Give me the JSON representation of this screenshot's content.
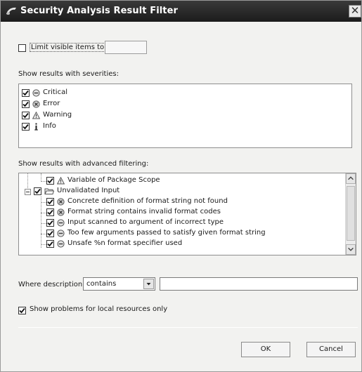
{
  "window": {
    "title": "Security Analysis Result Filter",
    "close_glyph": "✕"
  },
  "limit": {
    "label": "Limit visible items to:",
    "checked": false,
    "value": ""
  },
  "severities": {
    "label": "Show results with severities:",
    "items": [
      {
        "label": "Critical",
        "icon": "critical-icon",
        "checked": true
      },
      {
        "label": "Error",
        "icon": "error-icon",
        "checked": true
      },
      {
        "label": "Warning",
        "icon": "warning-icon",
        "checked": true
      },
      {
        "label": "Info",
        "icon": "info-icon",
        "checked": true
      }
    ]
  },
  "advanced": {
    "label": "Show results with advanced filtering:",
    "rows": [
      {
        "label": "Variable of Package Scope",
        "icon": "warning-icon",
        "checked": true
      },
      {
        "label": "Unvalidated Input",
        "icon": "folder-icon",
        "checked": true,
        "expanded": true
      },
      {
        "label": "Concrete definition of format string not found",
        "icon": "error-icon",
        "checked": true
      },
      {
        "label": "Format string contains invalid format codes",
        "icon": "error-icon",
        "checked": true
      },
      {
        "label": "Input scanned to argument of incorrect type",
        "icon": "critical-icon",
        "checked": true
      },
      {
        "label": "Too few arguments passed to satisfy given format string",
        "icon": "critical-icon",
        "checked": true
      },
      {
        "label": "Unsafe %n format specifier used",
        "icon": "critical-icon",
        "checked": true
      }
    ]
  },
  "where": {
    "label": "Where description",
    "operator": "contains",
    "value": ""
  },
  "local": {
    "label": "Show problems for local resources only",
    "checked": true
  },
  "buttons": {
    "ok": "OK",
    "cancel": "Cancel"
  },
  "colors": {
    "titlebar": "#2a2a2a",
    "window_bg": "#f2f2f0"
  }
}
